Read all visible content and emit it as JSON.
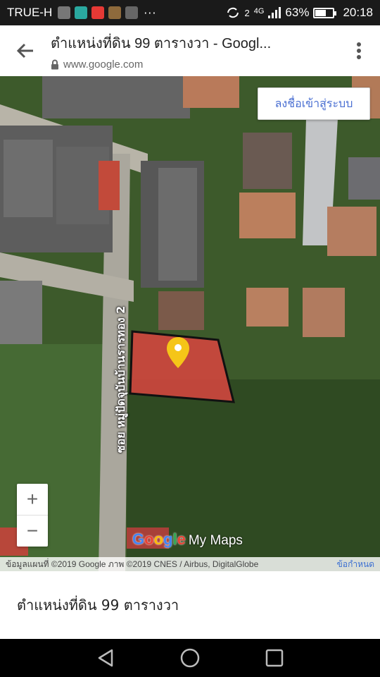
{
  "status_bar": {
    "carrier": "TRUE-H",
    "app_icon_colors": [
      "#777777",
      "#2aa9a0",
      "#e53935",
      "#8e6a3c",
      "#666666"
    ],
    "overflow": "···",
    "sim_number": "2",
    "network": "4G",
    "battery_percent": "63%",
    "battery_level": 0.63,
    "time": "20:18"
  },
  "browser": {
    "back_icon": "back-arrow-icon",
    "page_title": "ตำแหน่งที่ดิน 99 ตารางวา - Googl...",
    "url": "www.google.com",
    "lock_icon": "lock-icon",
    "menu_icon": "more-vert-icon"
  },
  "map": {
    "signin_label": "ลงชื่อเข้าสู่ระบบ",
    "road_label": "ซอย หมู่ปัดจุบันบ้านรารทอง 2",
    "zoom_in": "+",
    "zoom_out": "−",
    "logo_google": "Google",
    "logo_mymaps": "My Maps",
    "attribution": "ข้อมูลแผนที่ ©2019 Google ภาพ ©2019 CNES / Airbus, DigitalGlobe",
    "terms": "ข้อกำหนด",
    "parcel_color": "#d9453f",
    "pin_color": "#f5c518"
  },
  "info_card": {
    "title": "ตำแหน่งที่ดิน 99 ตารางวา"
  },
  "nav_bar": {
    "back_icon": "nav-back-icon",
    "home_icon": "nav-home-icon",
    "recents_icon": "nav-recents-icon"
  }
}
